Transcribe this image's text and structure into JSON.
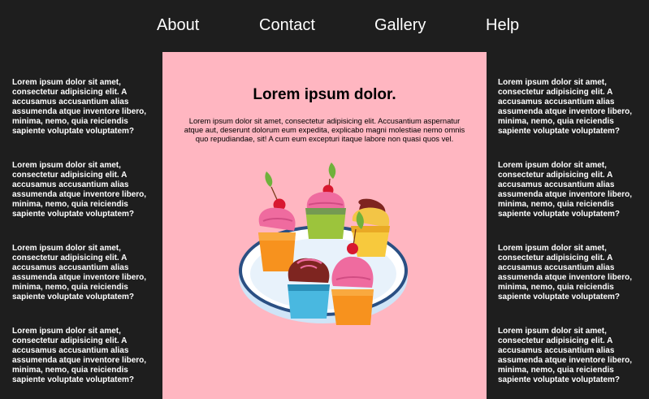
{
  "nav": {
    "items": [
      {
        "label": "About"
      },
      {
        "label": "Contact"
      },
      {
        "label": "Gallery"
      },
      {
        "label": "Help"
      }
    ]
  },
  "sidebar_left": {
    "paragraphs": [
      "Lorem ipsum dolor sit amet, consectetur adipisicing elit. A accusamus accusantium alias assumenda atque inventore libero, minima, nemo, quia reiciendis sapiente voluptate voluptatem?",
      "Lorem ipsum dolor sit amet, consectetur adipisicing elit. A accusamus accusantium alias assumenda atque inventore libero, minima, nemo, quia reiciendis sapiente voluptate voluptatem?",
      "Lorem ipsum dolor sit amet, consectetur adipisicing elit. A accusamus accusantium alias assumenda atque inventore libero, minima, nemo, quia reiciendis sapiente voluptate voluptatem?",
      "Lorem ipsum dolor sit amet, consectetur adipisicing elit. A accusamus accusantium alias assumenda atque inventore libero, minima, nemo, quia reiciendis sapiente voluptate voluptatem?"
    ]
  },
  "sidebar_right": {
    "paragraphs": [
      "Lorem ipsum dolor sit amet, consectetur adipisicing elit. A accusamus accusantium alias assumenda atque inventore libero, minima, nemo, quia reiciendis sapiente voluptate voluptatem?",
      "Lorem ipsum dolor sit amet, consectetur adipisicing elit. A accusamus accusantium alias assumenda atque inventore libero, minima, nemo, quia reiciendis sapiente voluptate voluptatem?",
      "Lorem ipsum dolor sit amet, consectetur adipisicing elit. A accusamus accusantium alias assumenda atque inventore libero, minima, nemo, quia reiciendis sapiente voluptate voluptatem?",
      "Lorem ipsum dolor sit amet, consectetur adipisicing elit. A accusamus accusantium alias assumenda atque inventore libero, minima, nemo, quia reiciendis sapiente voluptate voluptatem?"
    ]
  },
  "main": {
    "title": "Lorem ipsum dolor.",
    "lead": "Lorem ipsum dolor sit amet, consectetur adipisicing elit. Accusantium aspernatur atque aut, deserunt dolorum eum expedita, explicabo magni molestiae nemo omnis quo repudiandae, sit! A cum eum excepturi itaque labore non quasi quos vel.",
    "illustration": "cupcakes-on-plate"
  },
  "colors": {
    "page_background": "#1e1e1e",
    "main_background": "#ffb6c1",
    "text_light": "#ffffff",
    "text_dark": "#000000"
  }
}
